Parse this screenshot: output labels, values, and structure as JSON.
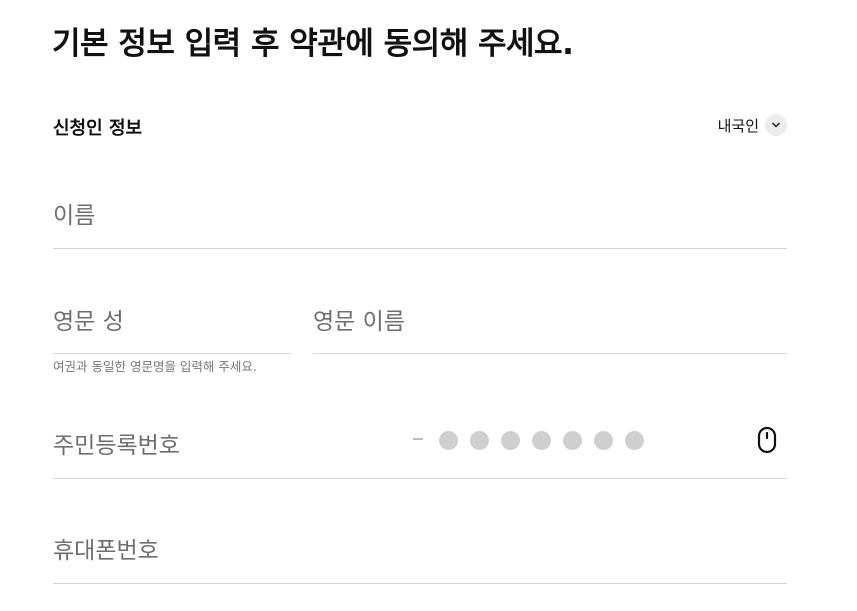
{
  "page": {
    "title": "기본 정보 입력 후 약관에 동의해 주세요."
  },
  "applicant": {
    "section_label": "신청인 정보",
    "nationality": {
      "selected": "내국인",
      "icon": "chevron-down-icon"
    }
  },
  "fields": {
    "name": {
      "label": "이름"
    },
    "english_surname": {
      "label": "영문 성"
    },
    "english_given_name": {
      "label": "영문 이름"
    },
    "english_name_help": "여권과 동일한 영문명을 입력해 주세요.",
    "resident_number": {
      "label": "주민등록번호",
      "masked_digit_count": 7,
      "icon": "mouse-icon"
    },
    "phone": {
      "label": "휴대폰번호"
    }
  },
  "colors": {
    "text_primary": "#111111",
    "label_gray": "#6e6e6e",
    "divider": "#d6d6d6",
    "mask_dot": "#cfcfcf"
  }
}
